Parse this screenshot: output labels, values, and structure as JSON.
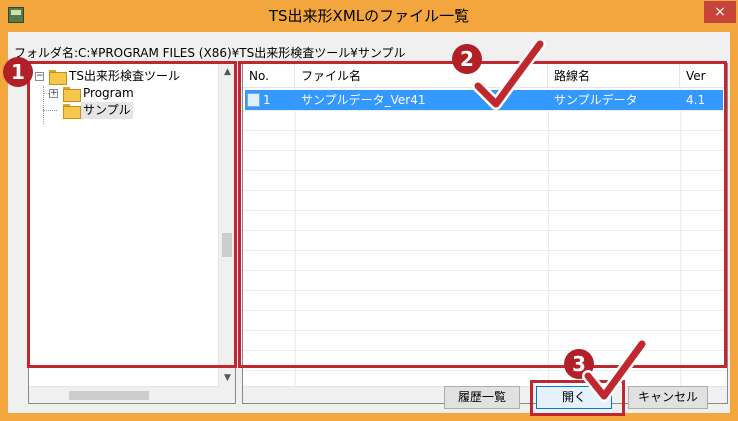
{
  "window": {
    "title": "TS出来形XMLのファイル一覧",
    "close_symbol": "×"
  },
  "folder_path": "フォルダ名:C:¥PROGRAM FILES (X86)¥TS出来形検査ツール¥サンプル",
  "tree": {
    "root": {
      "label": "TS出来形検査ツール",
      "expander": "−"
    },
    "children": [
      {
        "label": "Program",
        "expander": "+"
      },
      {
        "label": "サンプル"
      }
    ],
    "scroll_up": "▲",
    "scroll_down": "▼"
  },
  "file_list": {
    "columns": [
      "No.",
      "ファイル名",
      "路線名",
      "Ver"
    ],
    "rows": [
      {
        "no": "1",
        "filename": "サンプルデータ_Ver41",
        "route": "サンプルデータ",
        "ver": "4.1"
      }
    ]
  },
  "buttons": {
    "history": "履歴一覧",
    "open": "開く",
    "cancel": "キャンセル"
  },
  "callouts": [
    "1",
    "2",
    "3"
  ],
  "colors": {
    "accent": "#f3a63e",
    "highlight": "#c0282f",
    "badge": "#b11f27",
    "selection": "#3399ff",
    "close": "#c7443a"
  },
  "icons": [
    "app-icon",
    "close-icon",
    "folder-icon",
    "document-icon",
    "checkmark-icon"
  ]
}
